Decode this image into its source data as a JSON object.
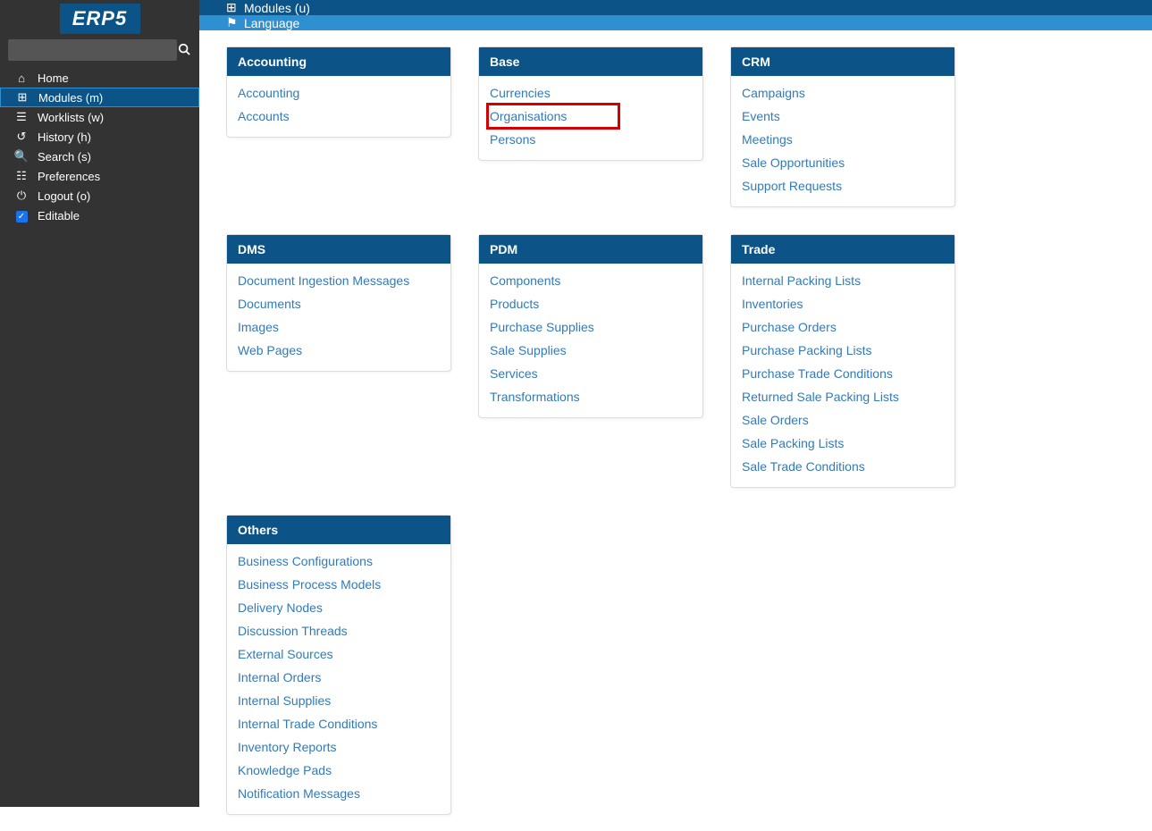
{
  "logo": "ERP5",
  "search": {
    "placeholder": ""
  },
  "sidebar": {
    "items": [
      {
        "icon": "home-icon",
        "glyph": "⌂",
        "label": "Home",
        "active": false,
        "checkbox": false
      },
      {
        "icon": "puzzle-icon",
        "glyph": "⊞",
        "label": "Modules (m)",
        "active": true,
        "checkbox": false
      },
      {
        "icon": "list-icon",
        "glyph": "☰",
        "label": "Worklists (w)",
        "active": false,
        "checkbox": false
      },
      {
        "icon": "history-icon",
        "glyph": "↺",
        "label": "History (h)",
        "active": false,
        "checkbox": false
      },
      {
        "icon": "search-icon",
        "glyph": "🔍",
        "label": "Search (s)",
        "active": false,
        "checkbox": false
      },
      {
        "icon": "sliders-icon",
        "glyph": "☷",
        "label": "Preferences",
        "active": false,
        "checkbox": false
      },
      {
        "icon": "power-icon",
        "glyph": "⏻",
        "label": "Logout (o)",
        "active": false,
        "checkbox": false
      },
      {
        "icon": "",
        "glyph": "",
        "label": "Editable",
        "active": false,
        "checkbox": true
      }
    ]
  },
  "topbar": {
    "line1": "Modules (u)",
    "line2": "Language"
  },
  "groups": [
    {
      "title": "Accounting",
      "links": [
        {
          "label": "Accounting",
          "highlight": false
        },
        {
          "label": "Accounts",
          "highlight": false
        }
      ]
    },
    {
      "title": "Base",
      "links": [
        {
          "label": "Currencies",
          "highlight": false
        },
        {
          "label": "Organisations",
          "highlight": true
        },
        {
          "label": "Persons",
          "highlight": false
        }
      ]
    },
    {
      "title": "CRM",
      "links": [
        {
          "label": "Campaigns",
          "highlight": false
        },
        {
          "label": "Events",
          "highlight": false
        },
        {
          "label": "Meetings",
          "highlight": false
        },
        {
          "label": "Sale Opportunities",
          "highlight": false
        },
        {
          "label": "Support Requests",
          "highlight": false
        }
      ]
    },
    {
      "title": "DMS",
      "links": [
        {
          "label": "Document Ingestion Messages",
          "highlight": false
        },
        {
          "label": "Documents",
          "highlight": false
        },
        {
          "label": "Images",
          "highlight": false
        },
        {
          "label": "Web Pages",
          "highlight": false
        }
      ]
    },
    {
      "title": "PDM",
      "links": [
        {
          "label": "Components",
          "highlight": false
        },
        {
          "label": "Products",
          "highlight": false
        },
        {
          "label": "Purchase Supplies",
          "highlight": false
        },
        {
          "label": "Sale Supplies",
          "highlight": false
        },
        {
          "label": "Services",
          "highlight": false
        },
        {
          "label": "Transformations",
          "highlight": false
        }
      ]
    },
    {
      "title": "Trade",
      "links": [
        {
          "label": "Internal Packing Lists",
          "highlight": false
        },
        {
          "label": "Inventories",
          "highlight": false
        },
        {
          "label": "Purchase Orders",
          "highlight": false
        },
        {
          "label": "Purchase Packing Lists",
          "highlight": false
        },
        {
          "label": "Purchase Trade Conditions",
          "highlight": false
        },
        {
          "label": "Returned Sale Packing Lists",
          "highlight": false
        },
        {
          "label": "Sale Orders",
          "highlight": false
        },
        {
          "label": "Sale Packing Lists",
          "highlight": false
        },
        {
          "label": "Sale Trade Conditions",
          "highlight": false
        }
      ]
    },
    {
      "title": "Others",
      "links": [
        {
          "label": "Business Configurations",
          "highlight": false
        },
        {
          "label": "Business Process Models",
          "highlight": false
        },
        {
          "label": "Delivery Nodes",
          "highlight": false
        },
        {
          "label": "Discussion Threads",
          "highlight": false
        },
        {
          "label": "External Sources",
          "highlight": false
        },
        {
          "label": "Internal Orders",
          "highlight": false
        },
        {
          "label": "Internal Supplies",
          "highlight": false
        },
        {
          "label": "Internal Trade Conditions",
          "highlight": false
        },
        {
          "label": "Inventory Reports",
          "highlight": false
        },
        {
          "label": "Knowledge Pads",
          "highlight": false
        },
        {
          "label": "Notification Messages",
          "highlight": false
        }
      ]
    }
  ]
}
